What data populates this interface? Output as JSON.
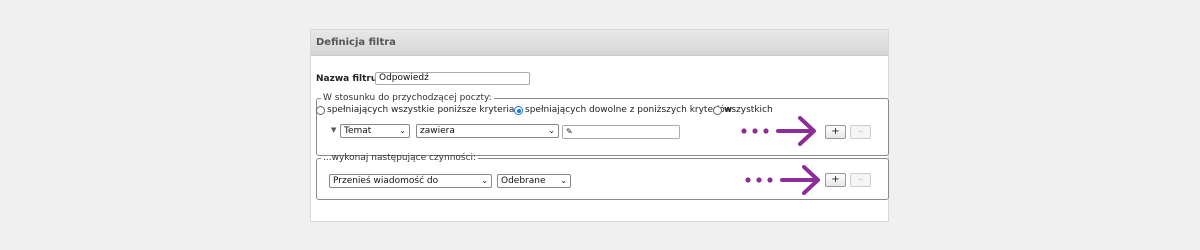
{
  "header": {
    "title": "Definicja filtra"
  },
  "filter_name": {
    "label": "Nazwa filtru:",
    "value": "Odpowiedź"
  },
  "conditions": {
    "legend": "W stosunku do przychodzącej poczty:",
    "radio_options": [
      {
        "label": "spełniających wszystkie poniższe kryteria",
        "selected": false
      },
      {
        "label": "spełniających dowolne z poniższych kryteriów",
        "selected": true
      },
      {
        "label": "wszystkich",
        "selected": false
      }
    ],
    "field_select": "Temat",
    "operator_select": "zawiera",
    "value_input": "",
    "add_label": "+",
    "remove_label": "–"
  },
  "actions": {
    "legend": "...wykonaj następujące czynności:",
    "action_select": "Przenieś wiadomość do",
    "folder_select": "Odebrane",
    "add_label": "+",
    "remove_label": "–"
  },
  "colors": {
    "arrow": "#8b2f97",
    "radio_selected": "#1a73e8"
  },
  "icons": [
    "chevron-down-icon",
    "edit-tag-icon",
    "arrow-right-icon"
  ]
}
